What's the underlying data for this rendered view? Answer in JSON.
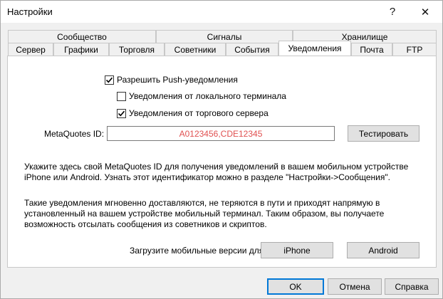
{
  "window": {
    "title": "Настройки",
    "help": "?",
    "close": "✕"
  },
  "tabs": {
    "row1": [
      "Сообщество",
      "Сигналы",
      "Хранилище"
    ],
    "row2": [
      "Сервер",
      "Графики",
      "Торговля",
      "Советники",
      "События",
      "Уведомления",
      "Почта",
      "FTP"
    ],
    "active": "Уведомления"
  },
  "notifications": {
    "enable_push": {
      "label": "Разрешить Push-уведомления",
      "checked": true
    },
    "from_local_terminal": {
      "label": "Уведомления от локального терминала",
      "checked": false
    },
    "from_trade_server": {
      "label": "Уведомления от торгового сервера",
      "checked": true
    },
    "metaquotes_id_label": "MetaQuotes ID:",
    "metaquotes_id_value": "A0123456,CDE12345",
    "test_button": "Тестировать",
    "info_text_1": "Укажите здесь свой MetaQuotes ID для получения уведомлений в вашем мобильном устройстве iPhone или Android. Узнать этот идентификатор можно в разделе \"Настройки->Сообщения\".",
    "info_text_2": "Такие уведомления мгновенно доставляются, не теряются в пути и приходят напрямую в установленный на вашем устройстве мобильный терминал. Таким образом, вы получаете возможность отсылать сообщения из советников и скриптов.",
    "download_label": "Загрузите мобильные версии для:",
    "iphone_button": "iPhone",
    "android_button": "Android"
  },
  "footer": {
    "ok": "OK",
    "cancel": "Отмена",
    "help": "Справка"
  },
  "colors": {
    "id_text": "#e05050",
    "default_button_border": "#0078d7"
  }
}
